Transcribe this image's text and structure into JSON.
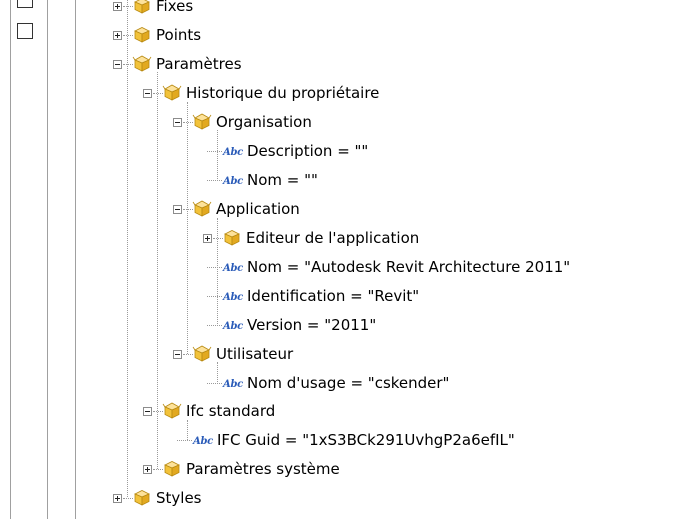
{
  "tree": {
    "nodes": [
      {
        "label": "Fixes",
        "icon": "folder-package-icon",
        "expander": "plus"
      },
      {
        "label": "Points",
        "icon": "folder-package-icon",
        "expander": "plus"
      },
      {
        "label": "Paramètres",
        "icon": "folder-package-open-icon",
        "expander": "minus"
      },
      {
        "label": "Historique du propriétaire",
        "icon": "folder-package-open-icon",
        "expander": "minus"
      },
      {
        "label": "Organisation",
        "icon": "folder-package-open-icon",
        "expander": "minus"
      },
      {
        "label": "Description = \"\"",
        "icon": "abc-string-icon"
      },
      {
        "label": "Nom = \"\"",
        "icon": "abc-string-icon"
      },
      {
        "label": "Application",
        "icon": "folder-package-open-icon",
        "expander": "minus"
      },
      {
        "label": "Editeur de l'application",
        "icon": "folder-package-icon",
        "expander": "plus"
      },
      {
        "label": "Nom = \"Autodesk Revit Architecture 2011\"",
        "icon": "abc-string-icon"
      },
      {
        "label": "Identification = \"Revit\"",
        "icon": "abc-string-icon"
      },
      {
        "label": "Version = \"2011\"",
        "icon": "abc-string-icon"
      },
      {
        "label": "Utilisateur",
        "icon": "folder-package-open-icon",
        "expander": "minus"
      },
      {
        "label": "Nom d'usage = \"cskender\"",
        "icon": "abc-string-icon"
      },
      {
        "label": "Ifc standard",
        "icon": "folder-package-open-icon",
        "expander": "minus"
      },
      {
        "label": "IFC Guid = \"1xS3BCk291UvhgP2a6efIL\"",
        "icon": "abc-string-icon"
      },
      {
        "label": "Paramètres système",
        "icon": "folder-package-icon",
        "expander": "plus"
      },
      {
        "label": "Styles",
        "icon": "folder-package-icon",
        "expander": "plus"
      }
    ],
    "abc_glyph": "Abc",
    "colors": {
      "package_icon": "#f2c23a",
      "abc_icon": "#2a5bb8",
      "tree_lines": "#9a9a9a"
    }
  }
}
